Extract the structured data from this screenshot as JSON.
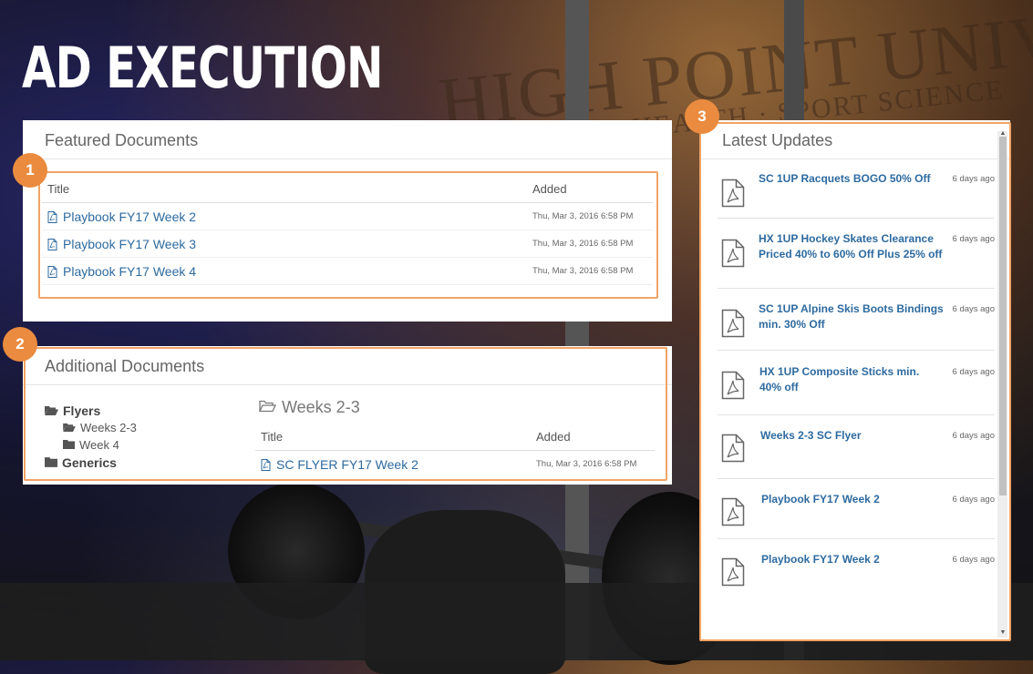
{
  "page": {
    "title": "AD EXECUTION"
  },
  "callouts": [
    "1",
    "2",
    "3"
  ],
  "featured": {
    "heading": "Featured Documents",
    "columns": {
      "title": "Title",
      "added": "Added"
    },
    "rows": [
      {
        "title": "Playbook FY17 Week 2",
        "added": "Thu, Mar 3, 2016 6:58 PM"
      },
      {
        "title": "Playbook FY17 Week 3",
        "added": "Thu, Mar 3, 2016 6:58 PM"
      },
      {
        "title": "Playbook FY17 Week 4",
        "added": "Thu, Mar 3, 2016 6:58 PM"
      }
    ]
  },
  "additional": {
    "heading": "Additional Documents",
    "tree": [
      {
        "label": "Flyers",
        "level": 0,
        "icon": "folder-open-icon"
      },
      {
        "label": "Weeks 2-3",
        "level": 1,
        "icon": "folder-open-icon"
      },
      {
        "label": "Week 4",
        "level": 1,
        "icon": "folder-icon"
      },
      {
        "label": "Generics",
        "level": 0,
        "icon": "folder-icon"
      }
    ],
    "current_folder": "Weeks 2-3",
    "columns": {
      "title": "Title",
      "added": "Added"
    },
    "rows": [
      {
        "title": "SC FLYER FY17 Week 2",
        "added": "Thu, Mar 3, 2016 6:58 PM"
      }
    ]
  },
  "updates": {
    "heading": "Latest Updates",
    "items": [
      {
        "title": "SC 1UP Racquets BOGO 50% Off",
        "age": "6 days ago"
      },
      {
        "title": "HX 1UP Hockey Skates Clearance Priced 40% to 60% Off Plus 25% off",
        "age": "6 days ago"
      },
      {
        "title": "SC 1UP Alpine Skis Boots Bindings min. 30% Off",
        "age": "6 days ago"
      },
      {
        "title": "HX 1UP Composite Sticks min. 40% off",
        "age": "6 days ago"
      },
      {
        "title": "Weeks 2-3 SC Flyer",
        "age": "6 days ago"
      },
      {
        "title": "Playbook FY17 Week 2",
        "age": "6 days ago"
      },
      {
        "title": "Playbook FY17 Week 2",
        "age": "6 days ago"
      }
    ]
  },
  "colors": {
    "accent": "#ea8b3f",
    "highlight": "#f2a365",
    "link": "#2d6a9f"
  }
}
